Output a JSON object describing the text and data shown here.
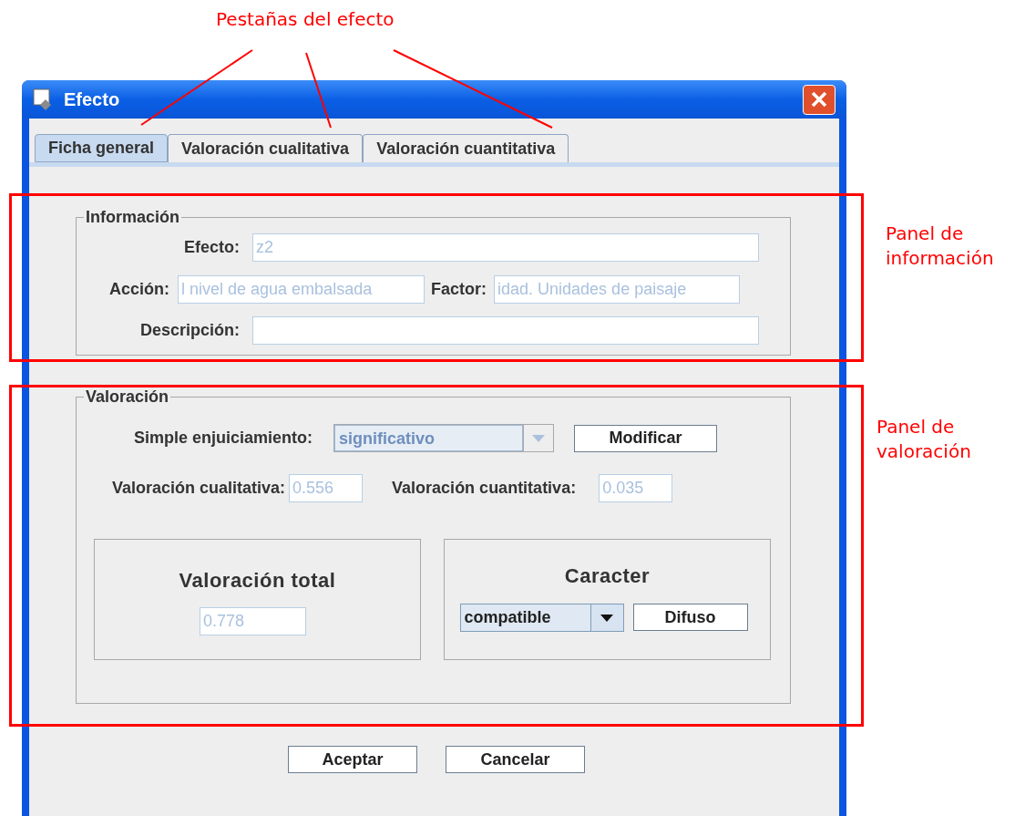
{
  "annotations": {
    "tabs_note": "Pestañas del efecto",
    "panels": [
      {
        "lines": [
          "Panel de",
          "información"
        ]
      },
      {
        "lines": [
          "Panel de",
          "valoración"
        ]
      }
    ]
  },
  "window": {
    "title": "Efecto"
  },
  "tabs": [
    {
      "label": "Ficha general",
      "selected": true
    },
    {
      "label": "Valoración cualitativa",
      "selected": false
    },
    {
      "label": "Valoración cuantitativa",
      "selected": false
    }
  ],
  "informacion": {
    "legend": "Información",
    "efecto": {
      "label": "Efecto:",
      "value": "z2"
    },
    "accion": {
      "label": "Acción:",
      "value": "l nivel de agua embalsada"
    },
    "factor": {
      "label": "Factor:",
      "value": "idad. Unidades de paisaje"
    },
    "descripcion": {
      "label": "Descripción:"
    }
  },
  "valoracion": {
    "legend": "Valoración",
    "simple": {
      "label": "Simple enjuiciamiento:",
      "value": "significativo",
      "disabled": true
    },
    "modify_button": "Modificar",
    "cualitativa": {
      "label": "Valoración cualitativa:",
      "value": "0.556"
    },
    "cuantitativa": {
      "label": "Valoración cuantitativa:",
      "value": "0.035"
    },
    "total": {
      "title": "Valoración total",
      "value": "0.778"
    },
    "caracter": {
      "title": "Caracter",
      "value": "compatible",
      "disabled": false
    },
    "fuzzy_button": "Difuso"
  },
  "buttons": [
    "Aceptar",
    "Cancelar"
  ]
}
